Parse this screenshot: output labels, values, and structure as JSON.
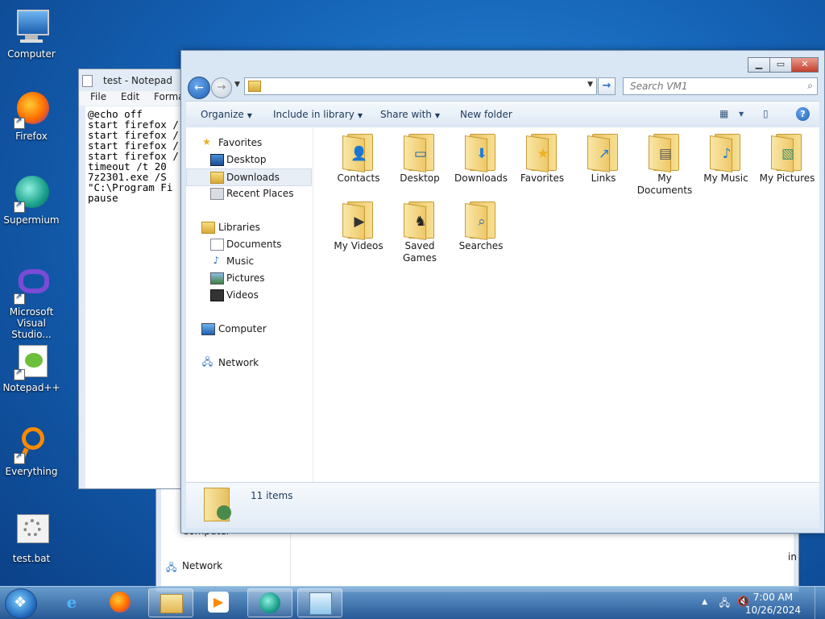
{
  "desktop": {
    "icons": [
      {
        "label": "Computer"
      },
      {
        "label": "Firefox"
      },
      {
        "label": "Supermium"
      },
      {
        "label": "Microsoft Visual Studio..."
      },
      {
        "label": "Notepad++"
      },
      {
        "label": "Everything"
      },
      {
        "label": "test.bat"
      }
    ]
  },
  "notepad": {
    "title": "test - Notepad",
    "menu": [
      "File",
      "Edit",
      "Format"
    ],
    "text": "@echo off\nstart firefox /\nstart firefox /\nstart firefox /\nstart firefox /\ntimeout /t 20\n7z2301.exe /S\n\"C:\\Program Fi\npause"
  },
  "bg_window": {
    "nav": [
      "Computer",
      "Network"
    ],
    "partial_text": "in"
  },
  "explorer": {
    "search_placeholder": "Search VM1",
    "commands": {
      "organize": "Organize",
      "include_in_library": "Include in library",
      "share_with": "Share with",
      "new_folder": "New folder"
    },
    "nav": {
      "favorites": "Favorites",
      "desktop": "Desktop",
      "downloads": "Downloads",
      "recent_places": "Recent Places",
      "libraries": "Libraries",
      "documents": "Documents",
      "music": "Music",
      "pictures": "Pictures",
      "videos": "Videos",
      "computer": "Computer",
      "network": "Network"
    },
    "folders": [
      {
        "label": "Contacts",
        "icon": "contacts-icon"
      },
      {
        "label": "Desktop",
        "icon": "desktop-icon"
      },
      {
        "label": "Downloads",
        "icon": "download-icon"
      },
      {
        "label": "Favorites",
        "icon": "star-icon"
      },
      {
        "label": "Links",
        "icon": "link-icon"
      },
      {
        "label": "My Documents",
        "icon": "document-icon"
      },
      {
        "label": "My Music",
        "icon": "music-icon"
      },
      {
        "label": "My Pictures",
        "icon": "picture-icon"
      },
      {
        "label": "My Videos",
        "icon": "video-icon"
      },
      {
        "label": "Saved Games",
        "icon": "chess-icon"
      },
      {
        "label": "Searches",
        "icon": "magnifier-icon"
      }
    ],
    "status": "11 items"
  },
  "taskbar": {
    "time": "7:00 AM",
    "date": "10/26/2024"
  },
  "colors": {
    "desktop_blue": "#1564b8",
    "accent": "#1e5fb4",
    "close_red": "#c3402c"
  }
}
